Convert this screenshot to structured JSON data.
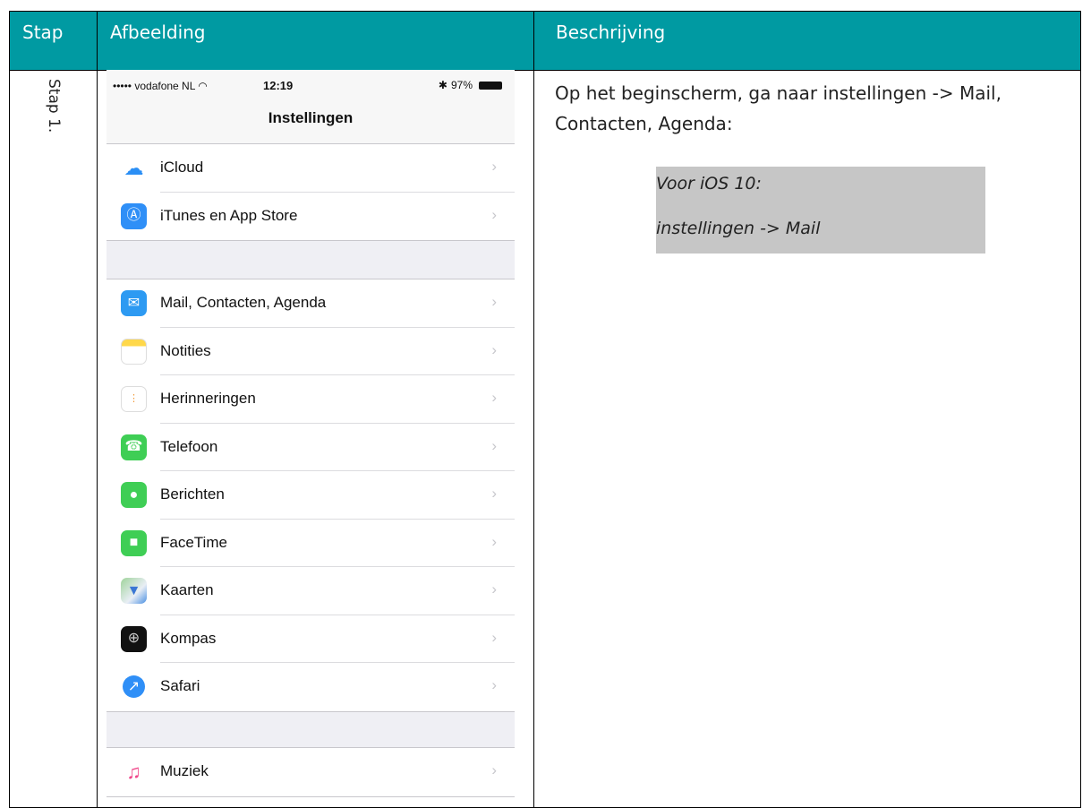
{
  "table": {
    "headers": {
      "stap": "Stap",
      "afbeelding": "Afbeelding",
      "beschrijving": "Beschrijving"
    },
    "step_label": "Stap 1."
  },
  "phone": {
    "status": {
      "carrier": "••••• vodafone NL",
      "time": "12:19",
      "battery": "97%"
    },
    "title": "Instellingen",
    "groups": [
      {
        "items": [
          {
            "label": "iCloud",
            "icon": "icloud-icon",
            "color": "#ffffff"
          },
          {
            "label": "iTunes en App Store",
            "icon": "app-store-icon",
            "color": "#2f8ff7"
          }
        ]
      },
      {
        "items": [
          {
            "label": "Mail, Contacten, Agenda",
            "icon": "mail-icon",
            "color": "#2d9af2"
          },
          {
            "label": "Notities",
            "icon": "notes-icon",
            "color": "#ffffff"
          },
          {
            "label": "Herinneringen",
            "icon": "reminders-icon",
            "color": "#ffffff"
          },
          {
            "label": "Telefoon",
            "icon": "phone-icon",
            "color": "#3fce55"
          },
          {
            "label": "Berichten",
            "icon": "messages-icon",
            "color": "#3fce55"
          },
          {
            "label": "FaceTime",
            "icon": "facetime-icon",
            "color": "#3fce55"
          },
          {
            "label": "Kaarten",
            "icon": "maps-icon",
            "color": "#dfe9df"
          },
          {
            "label": "Kompas",
            "icon": "compass-icon",
            "color": "#111111"
          },
          {
            "label": "Safari",
            "icon": "safari-icon",
            "color": "#ffffff"
          }
        ]
      },
      {
        "items": [
          {
            "label": "Muziek",
            "icon": "music-icon",
            "color": "#ffffff"
          }
        ]
      }
    ]
  },
  "description": {
    "text": "Op het beginscherm, ga naar instellingen -> Mail, Contacten, Agenda:",
    "note_line1": "Voor iOS 10:",
    "note_line2": "instellingen -> Mail"
  },
  "colors": {
    "header": "#009aa2",
    "note_bg": "#c6c6c6"
  }
}
